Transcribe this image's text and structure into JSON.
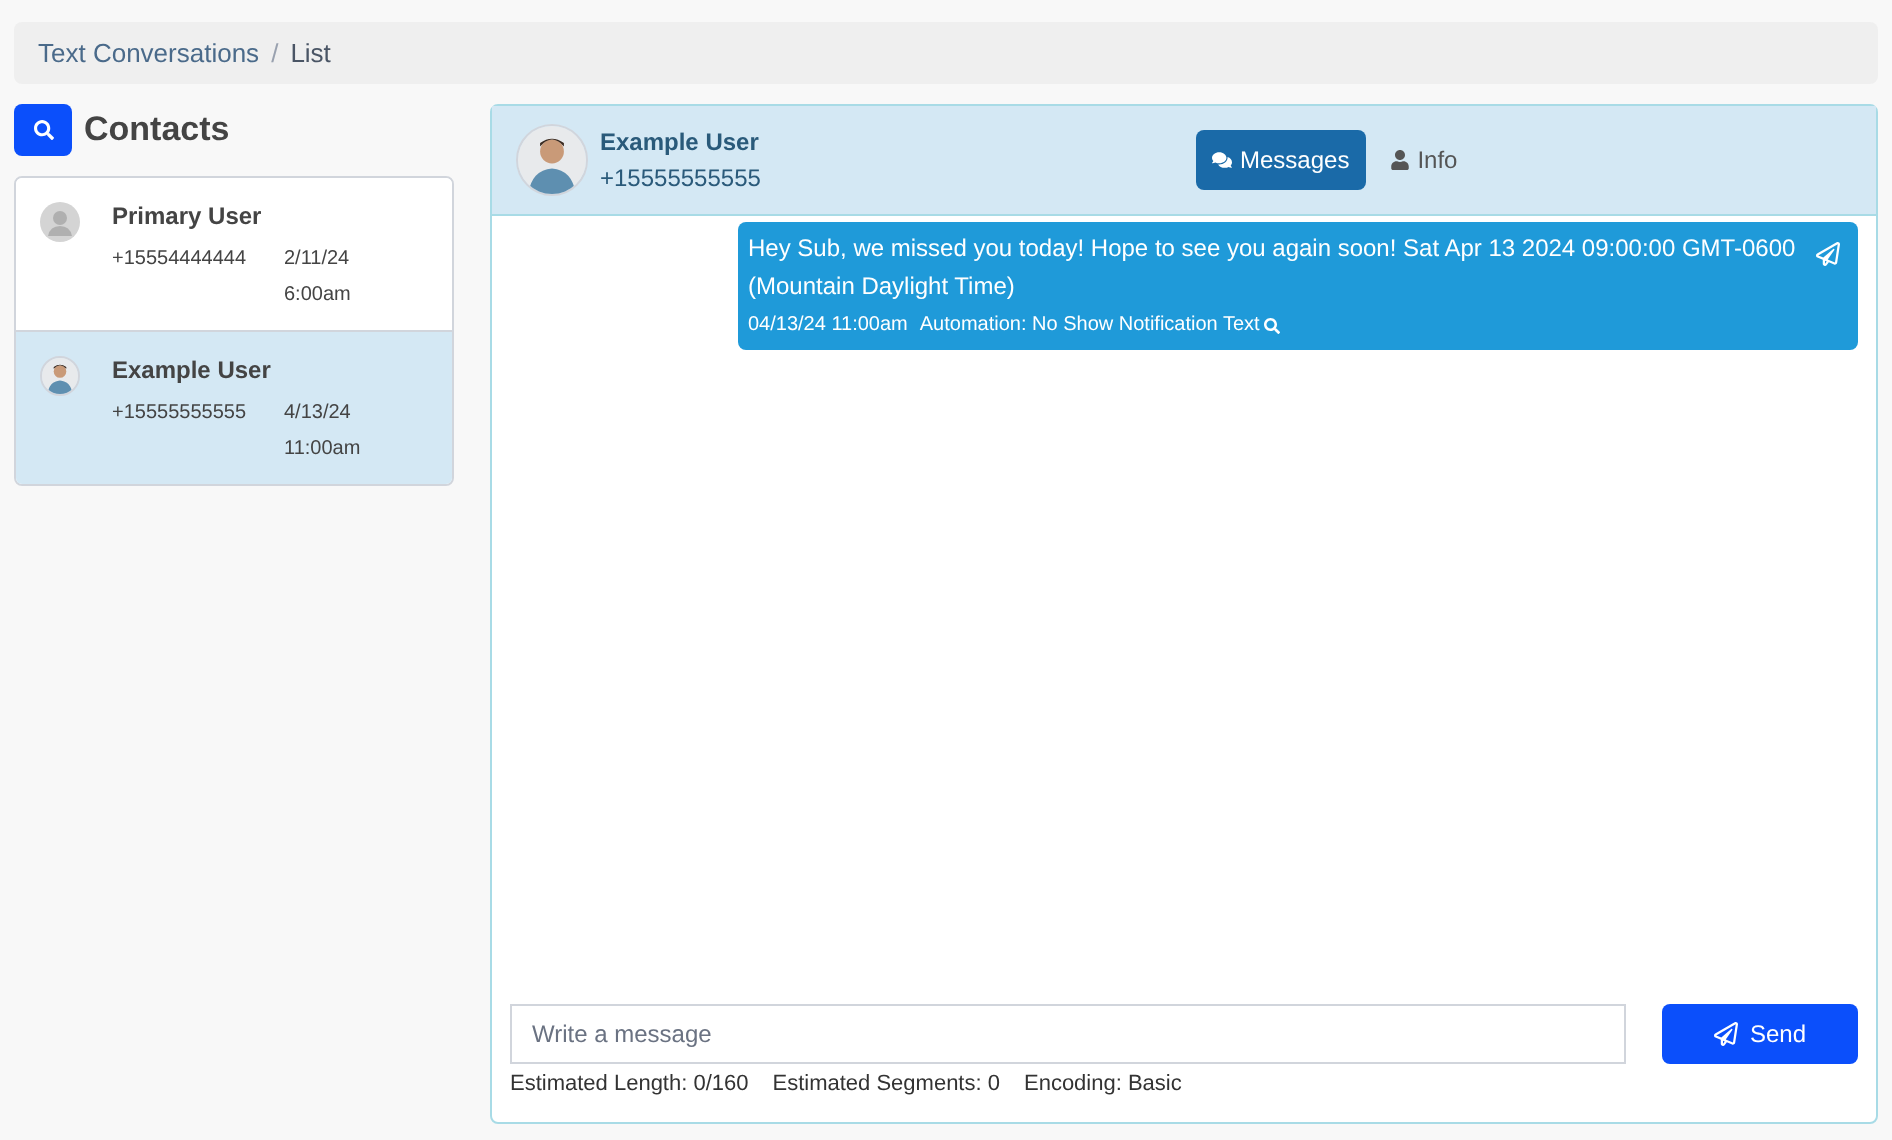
{
  "breadcrumb": [
    {
      "label": "Text Conversations",
      "link": true
    },
    {
      "label": "List",
      "link": false
    }
  ],
  "breadcrumb_separator": "/",
  "contacts_title": "Contacts",
  "contacts": [
    {
      "name": "Primary User",
      "phone": "+15554444444",
      "date": "2/11/24",
      "time": "6:00am",
      "selected": false,
      "kind": "default"
    },
    {
      "name": "Example User",
      "phone": "+15555555555",
      "date": "4/13/24",
      "time": "11:00am",
      "selected": true
    }
  ],
  "conversation": {
    "name": "Example User",
    "phone": "+15555555555",
    "tabs": [
      {
        "label": "Messages",
        "selected": true
      },
      {
        "label": "Info",
        "selected": false
      }
    ],
    "messages": [
      {
        "text": "Hey Sub, we missed you today! Hope to see you again soon! Sat Apr 13 2024 09:00:00 GMT-0600 (Mountain Daylight Time)",
        "timestamp": "04/13/24 11:00am",
        "source": "Automation: No Show Notification Text"
      }
    ],
    "composer": {
      "placeholder": "Write a message",
      "send": "Send",
      "stats": [
        "Estimated Length: 0/160",
        "Estimated Segments: 0",
        "Encoding: Basic"
      ]
    }
  }
}
